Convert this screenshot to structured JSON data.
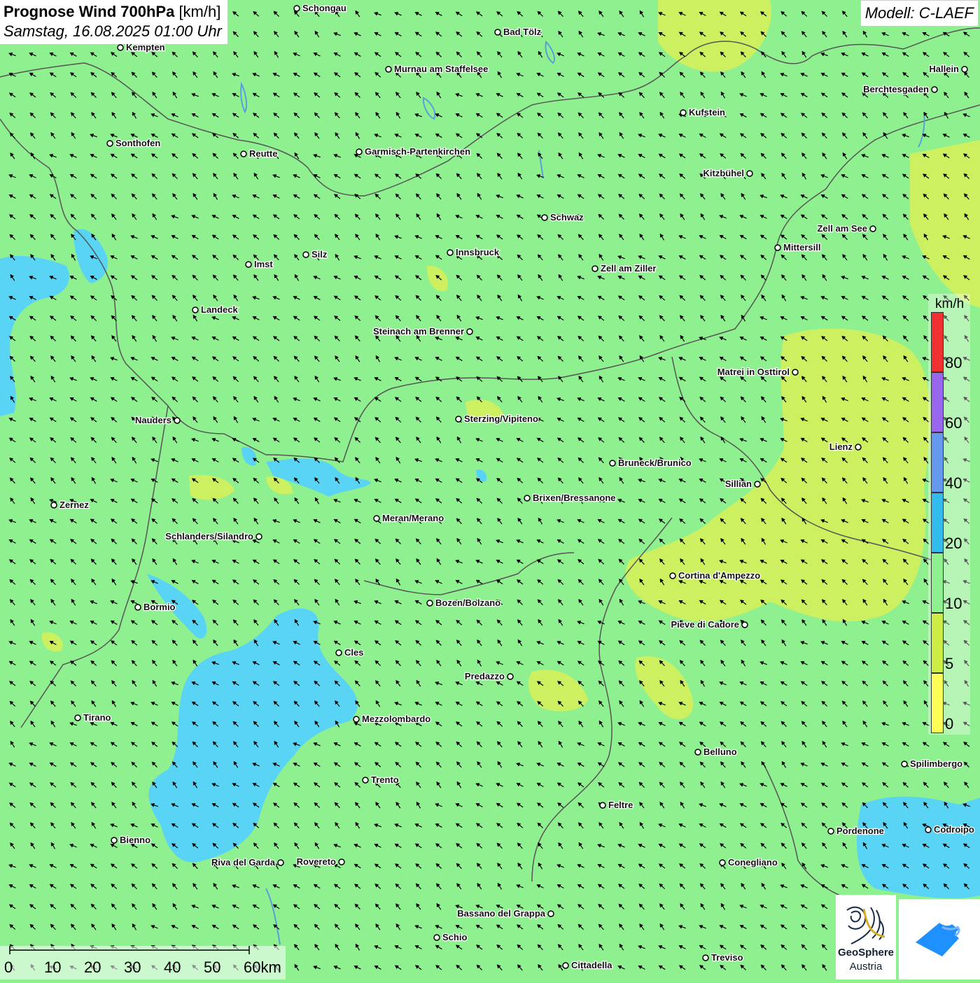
{
  "title": {
    "main": "Prognose Wind 700hPa",
    "unit": "[km/h]",
    "datetime": "Samstag, 16.08.2025 01:00 Uhr"
  },
  "model": "Modell: C-LAEF",
  "legend": {
    "unit": "km/h",
    "labels": [
      "80",
      "60",
      "40",
      "20",
      "10",
      "5",
      "0"
    ],
    "colors": [
      "#f03030",
      "#9966ee",
      "#6699ee",
      "#33bbee",
      "#8ff090",
      "#ccee44",
      "#ffff55"
    ]
  },
  "scale": {
    "ticks": [
      "0",
      "10",
      "20",
      "30",
      "40",
      "50",
      "60km"
    ]
  },
  "logo": {
    "line1": "GeoSphere",
    "line2": "Austria"
  },
  "colors": {
    "base": "#8ff090",
    "calm": "#d8f060",
    "fast": "#5ad4f4",
    "border": "#555555"
  },
  "cities": [
    {
      "name": "Schongau",
      "lon": 424,
      "lat": 12
    },
    {
      "name": "Bad Tölz",
      "lon": 711,
      "lat": 46
    },
    {
      "name": "Kempten",
      "lon": 172,
      "lat": 68
    },
    {
      "name": "Murnau am Staffelsee",
      "lon": 555,
      "lat": 99
    },
    {
      "name": "Hallein",
      "lon": 1378,
      "lat": 99
    },
    {
      "name": "Berchtesgaden",
      "lon": 1335,
      "lat": 128
    },
    {
      "name": "Kufstein",
      "lon": 976,
      "lat": 161
    },
    {
      "name": "Sonthofen",
      "lon": 157,
      "lat": 205
    },
    {
      "name": "Reutte",
      "lon": 348,
      "lat": 220
    },
    {
      "name": "Garmisch-Partenkirchen",
      "lon": 513,
      "lat": 217
    },
    {
      "name": "Kitzbühel",
      "lon": 1071,
      "lat": 248
    },
    {
      "name": "Schwaz",
      "lon": 778,
      "lat": 311
    },
    {
      "name": "Zell am See",
      "lon": 1247,
      "lat": 327
    },
    {
      "name": "Mittersill",
      "lon": 1111,
      "lat": 354
    },
    {
      "name": "Innsbruck",
      "lon": 643,
      "lat": 361
    },
    {
      "name": "Silz",
      "lon": 437,
      "lat": 364
    },
    {
      "name": "Imst",
      "lon": 355,
      "lat": 378
    },
    {
      "name": "Zell am Ziller",
      "lon": 850,
      "lat": 384
    },
    {
      "name": "Landeck",
      "lon": 279,
      "lat": 443
    },
    {
      "name": "Steinach am Brenner",
      "lon": 671,
      "lat": 474
    },
    {
      "name": "Matrei in Osttirol",
      "lon": 1136,
      "lat": 532
    },
    {
      "name": "Nauders",
      "lon": 253,
      "lat": 601
    },
    {
      "name": "Sterzing/Vipiteno",
      "lon": 655,
      "lat": 599
    },
    {
      "name": "Lienz",
      "lon": 1226,
      "lat": 639
    },
    {
      "name": "Bruneck/Brunico",
      "lon": 875,
      "lat": 662
    },
    {
      "name": "Sillian",
      "lon": 1082,
      "lat": 692
    },
    {
      "name": "Brixen/Bressanone",
      "lon": 753,
      "lat": 712
    },
    {
      "name": "Zernez",
      "lon": 77,
      "lat": 722
    },
    {
      "name": "Meran/Merano",
      "lon": 538,
      "lat": 741
    },
    {
      "name": "Schlanders/Silandro",
      "lon": 370,
      "lat": 767
    },
    {
      "name": "Cortina d'Ampezzo",
      "lon": 961,
      "lat": 823
    },
    {
      "name": "Bozen/Bolzano",
      "lon": 614,
      "lat": 862
    },
    {
      "name": "Bormio",
      "lon": 197,
      "lat": 868
    },
    {
      "name": "Pieve di Cadore",
      "lon": 1064,
      "lat": 893
    },
    {
      "name": "Cles",
      "lon": 484,
      "lat": 933
    },
    {
      "name": "Predazzo",
      "lon": 729,
      "lat": 967
    },
    {
      "name": "Tirano",
      "lon": 111,
      "lat": 1026
    },
    {
      "name": "Mezzolombardo",
      "lon": 509,
      "lat": 1028
    },
    {
      "name": "Belluno",
      "lon": 997,
      "lat": 1075
    },
    {
      "name": "Spilimbergo",
      "lon": 1292,
      "lat": 1092
    },
    {
      "name": "Trento",
      "lon": 522,
      "lat": 1115
    },
    {
      "name": "Feltre",
      "lon": 861,
      "lat": 1151
    },
    {
      "name": "Pordenone",
      "lon": 1187,
      "lat": 1188
    },
    {
      "name": "Codroipo",
      "lon": 1326,
      "lat": 1186
    },
    {
      "name": "Bienno",
      "lon": 163,
      "lat": 1201
    },
    {
      "name": "Riva del Garda",
      "lon": 401,
      "lat": 1233
    },
    {
      "name": "Rovereto",
      "lon": 488,
      "lat": 1232
    },
    {
      "name": "Conegliano",
      "lon": 1032,
      "lat": 1233
    },
    {
      "name": "Bassano del Grappa",
      "lon": 787,
      "lat": 1306
    },
    {
      "name": "Schio",
      "lon": 624,
      "lat": 1340
    },
    {
      "name": "Treviso",
      "lon": 1008,
      "lat": 1369
    },
    {
      "name": "Cittadella",
      "lon": 808,
      "lat": 1380
    }
  ]
}
